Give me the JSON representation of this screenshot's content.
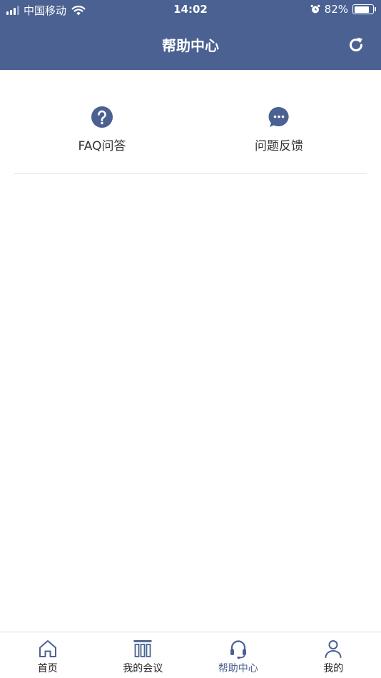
{
  "status_bar": {
    "carrier": "中国移动",
    "time": "14:02",
    "battery_percent": "82%",
    "battery_level": 0.82
  },
  "nav": {
    "title": "帮助中心",
    "refresh_icon": "refresh-icon"
  },
  "features": [
    {
      "label": "FAQ问答",
      "icon": "question-circle-icon"
    },
    {
      "label": "问题反馈",
      "icon": "chat-bubble-icon"
    }
  ],
  "tabbar": {
    "items": [
      {
        "label": "首页",
        "icon": "home-icon",
        "active": false
      },
      {
        "label": "我的会议",
        "icon": "meeting-columns-icon",
        "active": false
      },
      {
        "label": "帮助中心",
        "icon": "headset-icon",
        "active": true
      },
      {
        "label": "我的",
        "icon": "person-icon",
        "active": false
      }
    ]
  },
  "colors": {
    "brand": "#4a6192",
    "text": "#333333",
    "divider": "#e6e6e6"
  }
}
